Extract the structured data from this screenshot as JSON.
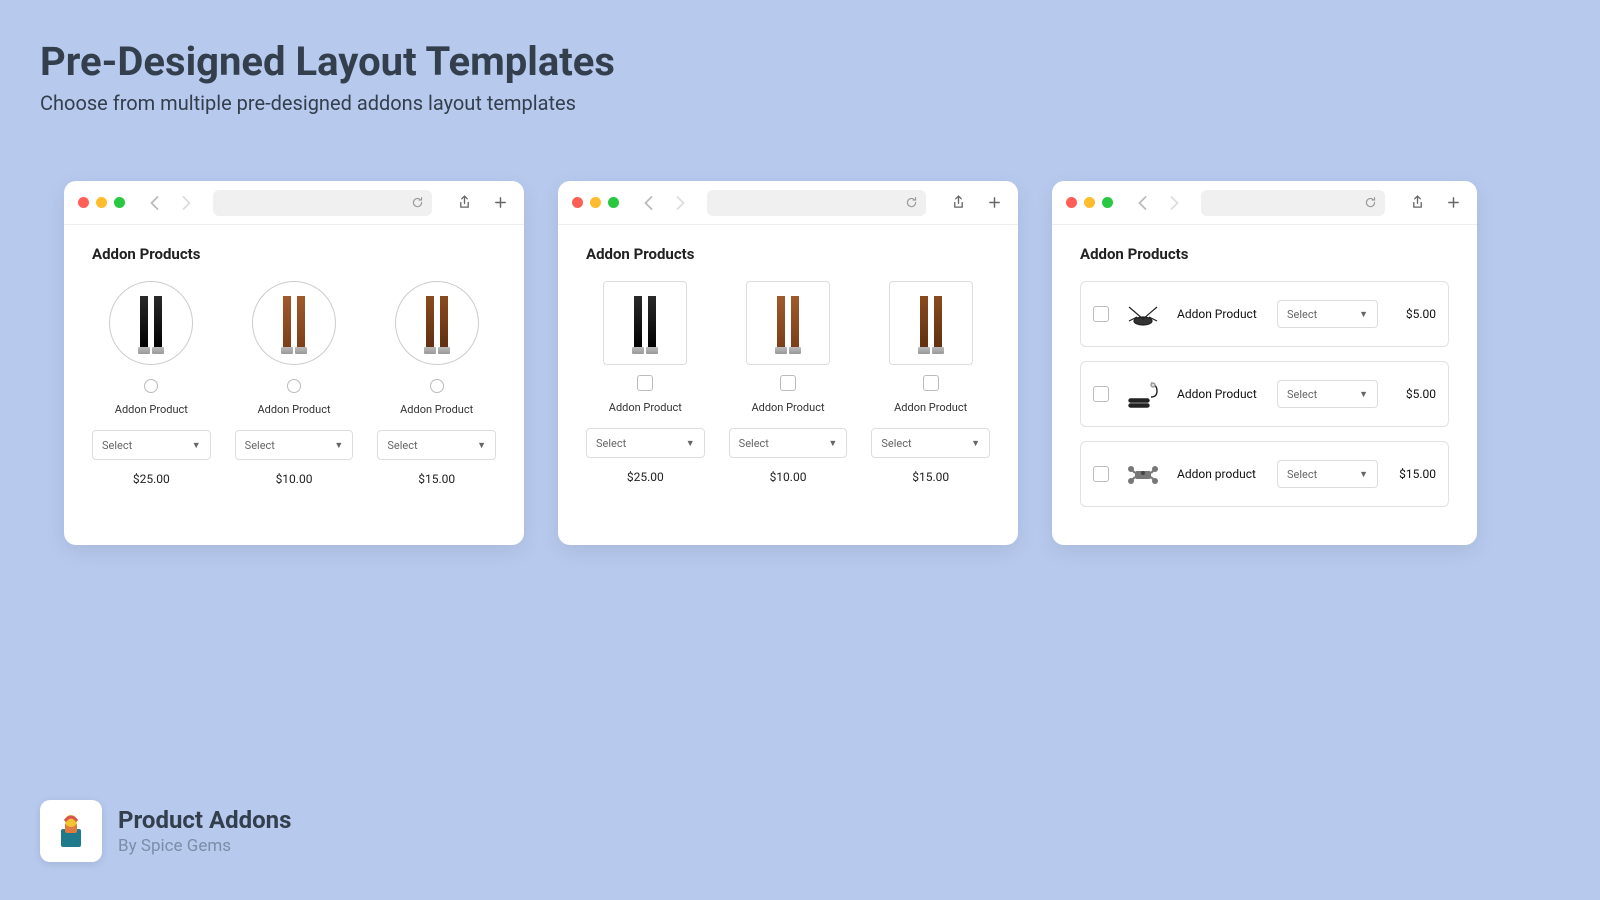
{
  "header": {
    "title": "Pre-Designed Layout Templates",
    "subtitle": "Choose from multiple pre-designed addons layout templates"
  },
  "section_heading": "Addon Products",
  "select_placeholder": "Select",
  "grid_items": [
    {
      "label": "Addon Product",
      "price": "$25.00",
      "color": "black"
    },
    {
      "label": "Addon Product",
      "price": "$10.00",
      "color": "tan"
    },
    {
      "label": "Addon Product",
      "price": "$15.00",
      "color": "brown"
    }
  ],
  "list_items": [
    {
      "label": "Addon Product",
      "price": "$5.00"
    },
    {
      "label": "Addon Product",
      "price": "$5.00"
    },
    {
      "label": "Addon product",
      "price": "$15.00"
    }
  ],
  "footer": {
    "app_name": "Product Addons",
    "byline": "By Spice Gems"
  }
}
